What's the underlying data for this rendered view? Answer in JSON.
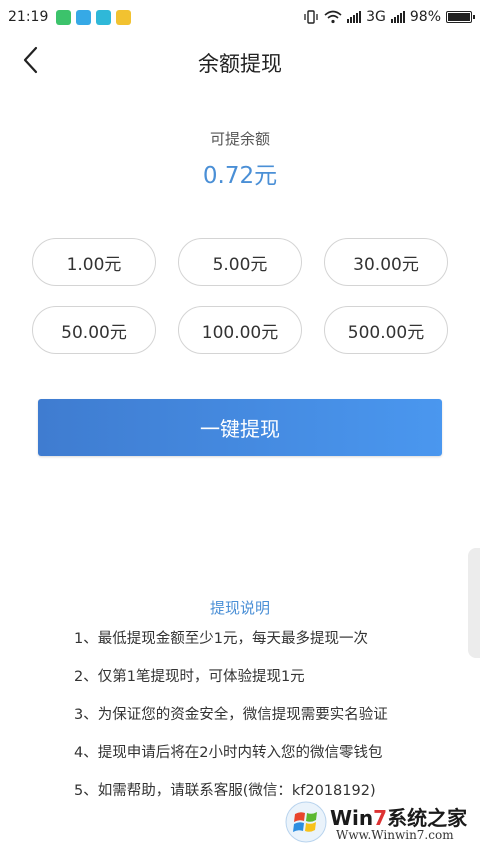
{
  "status_bar": {
    "time": "21:19",
    "network": "3G",
    "battery": "98%",
    "battery_level": 0.98
  },
  "header": {
    "title": "余额提现"
  },
  "balance": {
    "label": "可提余额",
    "value": "0.72元"
  },
  "amounts": [
    "1.00元",
    "5.00元",
    "30.00元",
    "50.00元",
    "100.00元",
    "500.00元"
  ],
  "withdraw_button": {
    "label": "一键提现"
  },
  "notes": {
    "title": "提现说明",
    "items": [
      "1、最低提现金额至少1元，每天最多提现一次",
      "2、仅第1笔提现时，可体验提现1元",
      "3、为保证您的资金安全，微信提现需要实名验证",
      "4、提现申请后将在2小时内转入您的微信零钱包",
      "5、如需帮助，请联系客服(微信：kf2018192)"
    ]
  },
  "watermark": {
    "brand_prefix": "Win",
    "brand_seven": "7",
    "brand_suffix": "系统之家",
    "url": "Www.Winwin7.com"
  },
  "colors": {
    "accent": "#4a8fd6",
    "button_start": "#3f7cd0",
    "button_end": "#4a97ef"
  },
  "icons": {
    "back": "chevron-left-icon"
  }
}
